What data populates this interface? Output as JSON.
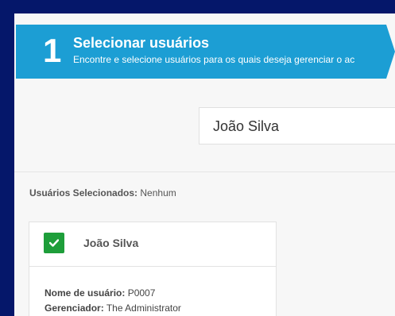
{
  "step": {
    "number": "1",
    "title": "Selecionar usuários",
    "subtitle": "Encontre e selecione usuários para os quais deseja gerenciar o ac"
  },
  "search": {
    "value": "João Silva"
  },
  "selection": {
    "label": "Usuários Selecionados:",
    "value": "Nenhum"
  },
  "user_card": {
    "name": "João Silva",
    "checked": true,
    "username_label": "Nome de usuário:",
    "username_value": "P0007",
    "manager_label": "Gerenciador:",
    "manager_value": "The Administrator"
  },
  "colors": {
    "background": "#05176a",
    "step_header": "#1c9ed4",
    "check": "#1e9e3a"
  }
}
